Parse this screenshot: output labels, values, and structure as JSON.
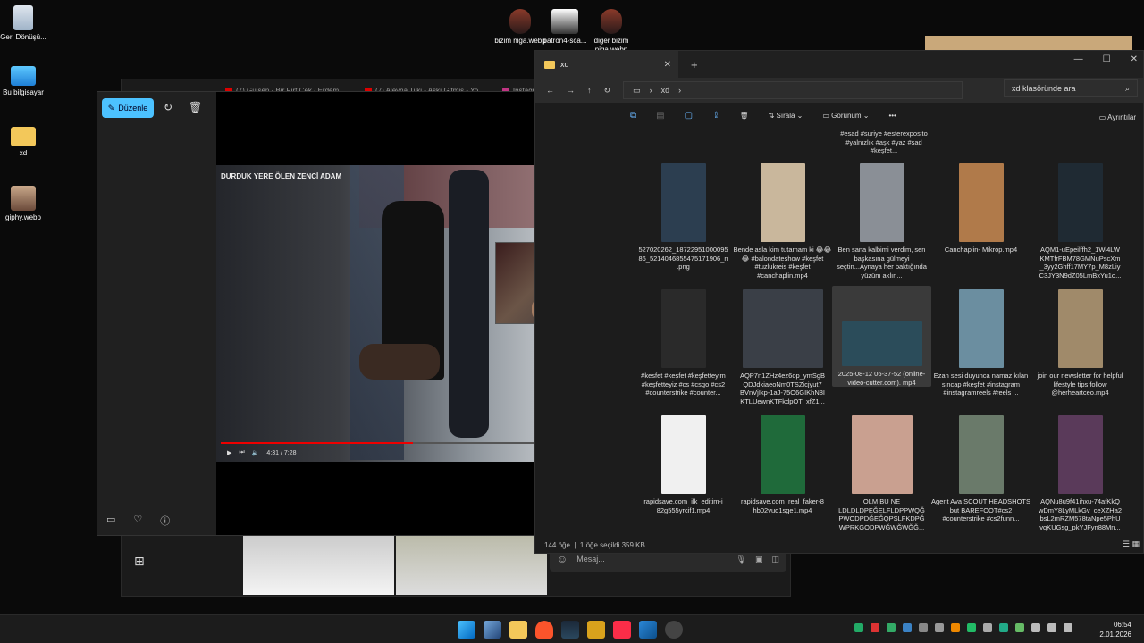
{
  "desktop": {
    "icons": [
      {
        "label": "Geri Dönüşü...",
        "icon": "recycle-bin-icon"
      },
      {
        "label": "Bu bilgisayar",
        "icon": "computer-icon"
      },
      {
        "label": "xd",
        "icon": "folder-icon"
      },
      {
        "label": "giphy.webp",
        "icon": "image-icon"
      }
    ],
    "top_icons": [
      {
        "label": "bizim niga.webp"
      },
      {
        "label": "patron4-sca..."
      },
      {
        "label": "diger bizim niga.webp"
      }
    ]
  },
  "browser_tabs": [
    "(7) Gülşen - Bir Fırt Çek / Erdem ...",
    "(7) Aleyna Tilki - Aşkı Gitmiş - Yo...",
    "Instagram"
  ],
  "photos": {
    "edit_label": "Düzenle",
    "video_title": "DURDUK YERE ÖLEN ZENCİ ADAM",
    "time": "4:31 / 7:28",
    "progress": 0.48
  },
  "explorer": {
    "tab_title": "xd",
    "breadcrumb": "xd",
    "search_placeholder": "xd klasöründe ara",
    "sort_label": "Sırala",
    "view_label": "Görünüm",
    "details_label": "Ayrıntılar",
    "status_count": "144 öğe",
    "status_selected": "1 öğe seçildi 359 KB",
    "prev_caption": "#esad #suriye #esterexposito #yalnızlık #aşk #yaz #sad #keşfet...",
    "files": [
      {
        "name": "527020262_18722951000095 86_5214046855475171906_n .png",
        "thumb": "#2c3e50"
      },
      {
        "name": "Bende asla kim tutamam ki 😂😂😂 #balondateshow #keşfet #tuzlukreis #keşfet #canchaplin.mp4",
        "thumb": "#c9b79c"
      },
      {
        "name": "Ben sana kalbimi verdim, sen başkasına gülmeyi seçtin...Aynaya her baktığında yüzüm aklın...",
        "thumb": "#8a8f96"
      },
      {
        "name": "Canchaplin- Mikrop.mp4",
        "thumb": "#b07a4a"
      },
      {
        "name": "AQM1-uEpeilffh2_1Wi4LW KMTfrFBM78GMNuPscXm _3yy2Ghff17MY7p_M8zLiy C3JY3N9dZ05LmBxYu1o...",
        "thumb": "#1f2a33"
      },
      {
        "name": "#kesfet #keşfet #keşfetteyim #keşfetteyiz #cs #csgo #cs2 #counterstrike #counter...",
        "thumb": "#2a2a2a"
      },
      {
        "name": "AQP7n1ZHz4ez6op_ymSgB QDJdkiaeoNm0TSZicjyut7 BVnVjIkp-1aJ-75O6GIKhN8I KTLUewnKTFkdpOT_xfZ1...",
        "thumb": "#3a3f47"
      },
      {
        "name": "2025-08-12 06-37-52 (online-video-cutter.com). mp4",
        "thumb": "#2b4c5a"
      },
      {
        "name": "Ezan sesi duyunca namaz kılan sincap #keşfet #instagram #instagramreels #reels ...",
        "thumb": "#6b8ea0"
      },
      {
        "name": "join our newsletter for helpful lifestyle tips follow @herheartceo.mp4",
        "thumb": "#a08a6a"
      },
      {
        "name": "rapidsave.com_ilk_editim-i 82g555yrcif1.mp4",
        "thumb": "#f0f0f0"
      },
      {
        "name": "rapidsave.com_real_faker-8 hb02vud1sge1.mp4",
        "thumb": "#1f6a3a"
      },
      {
        "name": "OLM BU NE LDLDLDPEĞELFLDPPWQĞ PWODPDĞEĞQPSLFKDPĞ WPRKGODPWĞWĞWĞĞ...",
        "thumb": "#c9a090"
      },
      {
        "name": "Agent Ava SCOUT HEADSHOTS but BAREFOOT#cs2 #counterstrike #cs2funn...",
        "thumb": "#6a7a6a"
      },
      {
        "name": "AQNu8u9f41ihxu-74afKkQ wDmY8LyMLkGv_ceXZHa2 bsL2mRZM578taNpe5PhU vqKUGsg_pkYJFyn88Mn...",
        "thumb": "#5a3a5a"
      }
    ]
  },
  "chat": {
    "placeholder": "Mesaj..."
  },
  "taskbar": {
    "time": "06:54",
    "date": "2.01.2026"
  },
  "colors": {
    "accent": "#4cc2ff",
    "progress": "#e00000",
    "folder": "#f3c85a"
  }
}
